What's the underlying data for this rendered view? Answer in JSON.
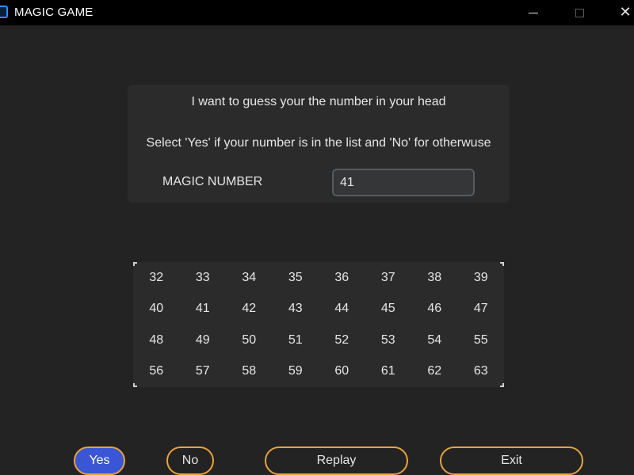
{
  "window": {
    "title": "MAGIC GAME",
    "close_glyph": "✕"
  },
  "info": {
    "line1": "I want to guess your the number in your head",
    "line2": "Select 'Yes' if your number is in the list and 'No' for otherwuse",
    "magic_label": "MAGIC NUMBER",
    "magic_value": "41"
  },
  "numbers": [
    [
      "32",
      "33",
      "34",
      "35",
      "36",
      "37",
      "38",
      "39"
    ],
    [
      "40",
      "41",
      "42",
      "43",
      "44",
      "45",
      "46",
      "47"
    ],
    [
      "48",
      "49",
      "50",
      "51",
      "52",
      "53",
      "54",
      "55"
    ],
    [
      "56",
      "57",
      "58",
      "59",
      "60",
      "61",
      "62",
      "63"
    ]
  ],
  "buttons": {
    "yes": "Yes",
    "no": "No",
    "replay": "Replay",
    "exit": "Exit"
  },
  "colors": {
    "accent_border": "#e8a33c",
    "yes_fill": "#3a56d4",
    "background": "#232323",
    "panel": "#2b2b2b"
  }
}
